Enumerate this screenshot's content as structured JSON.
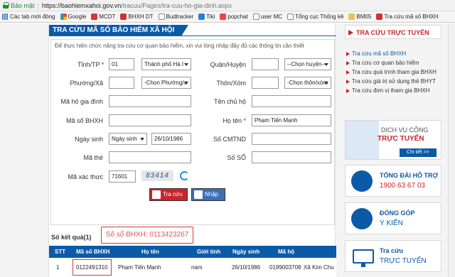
{
  "browser": {
    "secure_label": "Bảo mật",
    "url_host": "https://baohiemxahoi.gov.vn",
    "url_path": "/tracuu/Pages/tra-cuu-ho-gia-dinh.aspx",
    "bookmarks": [
      "Các tab mới đóng",
      "Google",
      "MCDT",
      "BHXH DT",
      "Budtracker",
      "Tiki",
      "popchat",
      "user MC",
      "Tổng cục Thống kê",
      "BM05",
      "Tra cứu mã số BHXH"
    ]
  },
  "form": {
    "title": "TRA CỨU MÃ SỐ BẢO HIỂM XÃ HỘI",
    "hint": "Để thực hiện chức năng tra cứu cơ quan bảo hiểm, xin vui lòng nhập đầy đủ các thông tin cần thiết",
    "province_label": "Tỉnh/TP",
    "province_code": "01",
    "province_value": "Thành phố Hà I",
    "district_label": "Quận/Huyện",
    "district_value": "--Chọn huyện--",
    "ward_label": "Phường/Xã",
    "ward_value": "-Chọn Phường/x",
    "hamlet_label": "Thôn/Xóm",
    "hamlet_value": "-Chọn thôn/xóm",
    "household_code_label": "Mã hộ gia đình",
    "household_head_label": "Tên chủ hộ",
    "bhxh_code_label": "Mã số BHXH",
    "fullname_label": "Họ tên",
    "fullname_value": "Phạm Tiến Mạnh",
    "dob_label": "Ngày sinh",
    "dob_type_value": "Ngày sinh",
    "dob_value": "26/10/1986",
    "id_label": "Số CMTND",
    "card_label": "Mã thẻ",
    "phone_label": "Số SỐ",
    "captcha_label": "Mã xác thực",
    "captcha_input": "71601",
    "captcha_image": "83414",
    "search_btn": "Tra cứu",
    "reset_btn": "Nhập lại",
    "required_mark": "*"
  },
  "results": {
    "label": "Số kết quả(1)",
    "annotation": "Số sổ BHXH: 0113423267",
    "columns": [
      "STT",
      "Mã số BHXH",
      "Họ tên",
      "Giới tính",
      "Ngày sinh",
      "Mã hộ"
    ],
    "row": [
      "1",
      "0122491310",
      "Phạm Tiến Mạnh",
      "nam",
      "26/10/1986",
      "0199003708",
      "Xã Kim Chu"
    ]
  },
  "sidebar": {
    "title": "TRA CỨU TRỰC TUYẾN",
    "items": [
      "Tra cứu mã số BHXH",
      "Tra cứu cơ quan bảo hiểm",
      "Tra cứu quá trình tham gia BHXH",
      "Tra cứu giá trị sử dụng thẻ BHYT",
      "Tra cứu đơn vị tham gia BHXH"
    ],
    "banner1_line1": "DỊCH VỤ CÔNG",
    "banner1_line2": "TRỰC TUYẾN",
    "banner1_btn": "Chi tiết >>",
    "banner2_line1": "TỔNG ĐÀI HỖ TRỢ",
    "banner2_line2": "1900 63 67 03",
    "banner3_line1": "ĐÓNG GÓP",
    "banner3_line2": "Ý KIẾN",
    "banner4_line1": "Tra cứu",
    "banner4_line2": "TRỰC TUYẾN"
  }
}
